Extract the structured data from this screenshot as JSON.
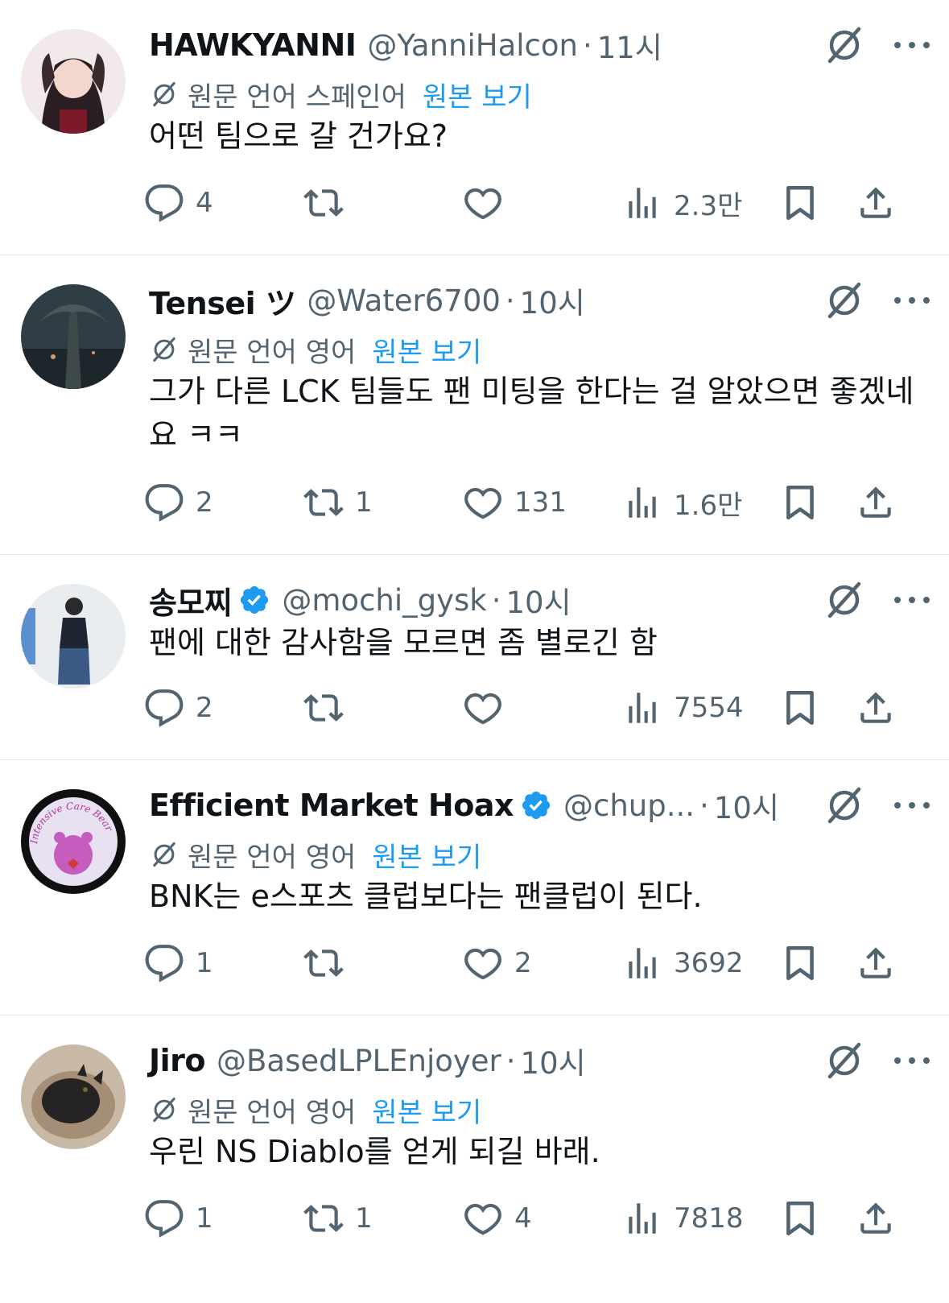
{
  "tweets": [
    {
      "name": "HAWKYANNI",
      "handle": "@YanniHalcon",
      "dot": "·",
      "time": "11시",
      "verified": false,
      "translation": {
        "text": "원문 언어 스페인어",
        "link": "원본 보기"
      },
      "text": "어떤 팀으로 갈 건가요?",
      "replies": "4",
      "retweets": "",
      "likes": "",
      "views": "2.3만",
      "avatar_icon": "user-avatar"
    },
    {
      "name": "Tensei ツ",
      "handle": "@Water6700",
      "dot": "·",
      "time": "10시",
      "verified": false,
      "translation": {
        "text": "원문 언어 영어",
        "link": "원본 보기"
      },
      "text": "그가 다른 LCK 팀들도 팬 미팅을 한다는 걸 알았으면 좋겠네요 ㅋㅋ",
      "replies": "2",
      "retweets": "1",
      "likes": "131",
      "views": "1.6만",
      "avatar_icon": "user-avatar"
    },
    {
      "name": "송모찌",
      "handle": "@mochi_gysk",
      "dot": "·",
      "time": "10시",
      "verified": true,
      "translation": null,
      "text": "팬에 대한 감사함을 모르면 좀 별로긴 함",
      "replies": "2",
      "retweets": "",
      "likes": "",
      "views": "7554",
      "avatar_icon": "user-avatar"
    },
    {
      "name": "Efficient Market Hoax",
      "handle": "@chup...",
      "dot": "·",
      "time": "10시",
      "verified": true,
      "translation": {
        "text": "원문 언어 영어",
        "link": "원본 보기"
      },
      "text": "BNK는 e스포츠 클럽보다는 팬클럽이 된다.",
      "replies": "1",
      "retweets": "",
      "likes": "2",
      "views": "3692",
      "avatar_icon": "user-avatar",
      "avatar_text": "Intensive Care Bear"
    },
    {
      "name": "Jiro",
      "handle": "@BasedLPLEnjoyer",
      "dot": "·",
      "time": "10시",
      "verified": false,
      "translation": {
        "text": "원문 언어 영어",
        "link": "원본 보기"
      },
      "text": "우린 NS Diablo를 얻게 되길 바래.",
      "replies": "1",
      "retweets": "1",
      "likes": "4",
      "views": "7818",
      "avatar_icon": "user-avatar"
    }
  ],
  "colors": {
    "text": "#0f1419",
    "secondary": "#536471",
    "link": "#1d9bf0",
    "divider": "#e1e6ea"
  }
}
